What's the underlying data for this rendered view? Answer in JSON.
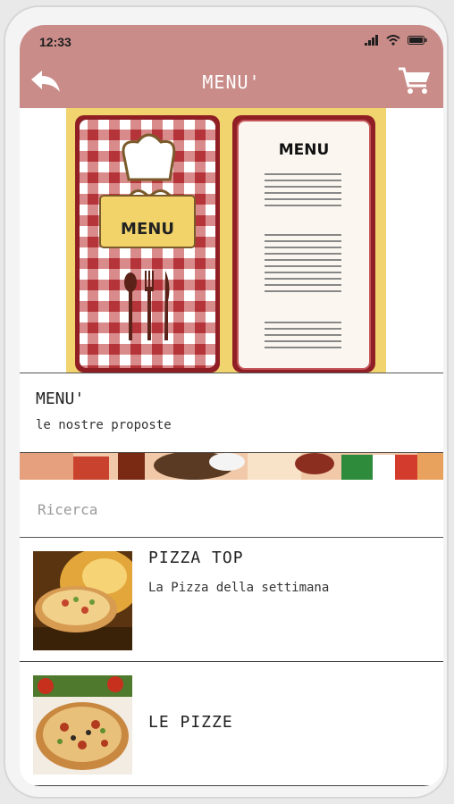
{
  "status": {
    "time": "12:33",
    "icons": [
      "signal-icon",
      "wifi-icon",
      "battery-icon"
    ]
  },
  "navbar": {
    "title": "MENU'",
    "back_icon": "back-arrow-icon",
    "cart_icon": "cart-icon"
  },
  "hero": {
    "card_text": "MENU",
    "board_text": "MENU"
  },
  "section": {
    "title": "MENU'",
    "subtitle": "le nostre proposte"
  },
  "search": {
    "placeholder": "Ricerca",
    "value": ""
  },
  "items": [
    {
      "title": "PIZZA TOP",
      "subtitle": "La Pizza della settimana"
    },
    {
      "title": "LE PIZZE",
      "subtitle": ""
    }
  ],
  "colors": {
    "header": "#c98c89",
    "divider": "#555555",
    "menu_frame": "#f2d46f",
    "checker_red": "#b5343a"
  }
}
